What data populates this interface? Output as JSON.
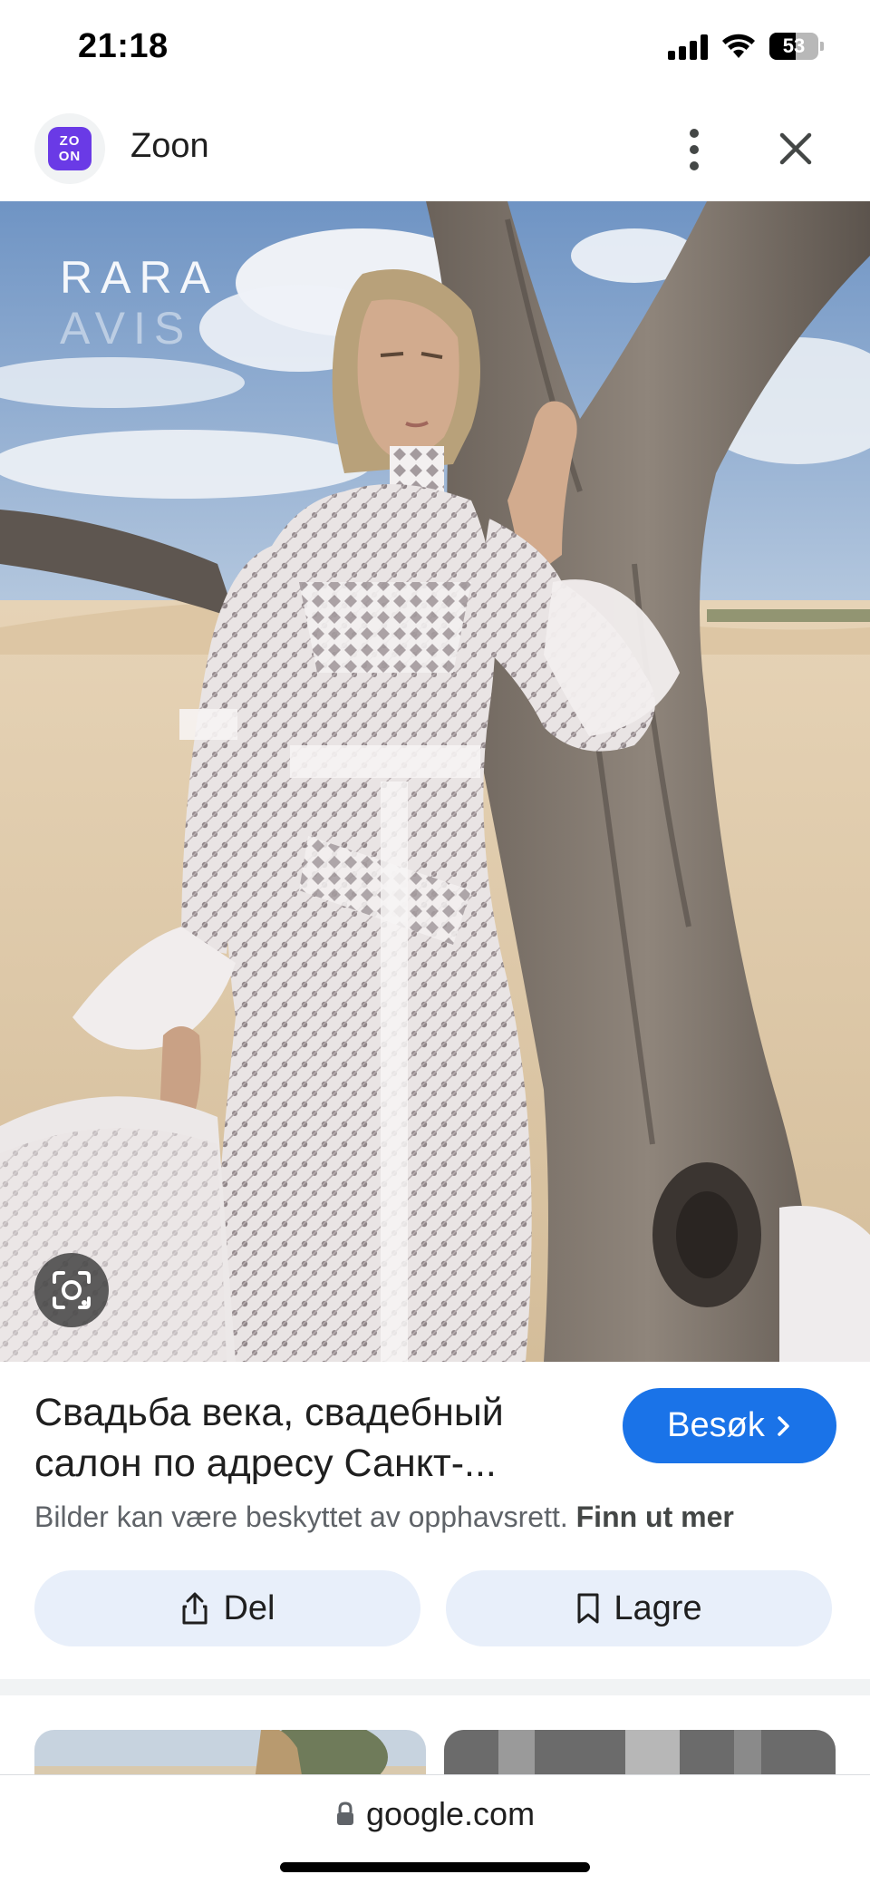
{
  "status_bar": {
    "time": "21:18",
    "battery_level": "53",
    "icons": [
      "signal-icon",
      "wifi-icon",
      "battery-icon"
    ]
  },
  "header": {
    "site_logo_text": "ZOON",
    "site_name": "Zoon",
    "icons": [
      "more-vertical-icon",
      "close-icon"
    ]
  },
  "image": {
    "brand_line1": "RARA",
    "brand_line2": "AVIS",
    "lens_icon": "google-lens-icon"
  },
  "result": {
    "title": "Свадьба века, свадебный салон по адресу Санкт-...",
    "visit_label": "Besøk",
    "copyright_text": "Bilder kan være beskyttet av opphavsrett.",
    "learn_more": "Finn ut mer"
  },
  "actions": {
    "share_label": "Del",
    "save_label": "Lagre"
  },
  "bottom_bar": {
    "url": "google.com",
    "lock_icon": "lock-icon"
  },
  "colors": {
    "accent": "#1a73e8",
    "action_bg": "#e8effa",
    "logo_purple": "#6a3ae6"
  }
}
